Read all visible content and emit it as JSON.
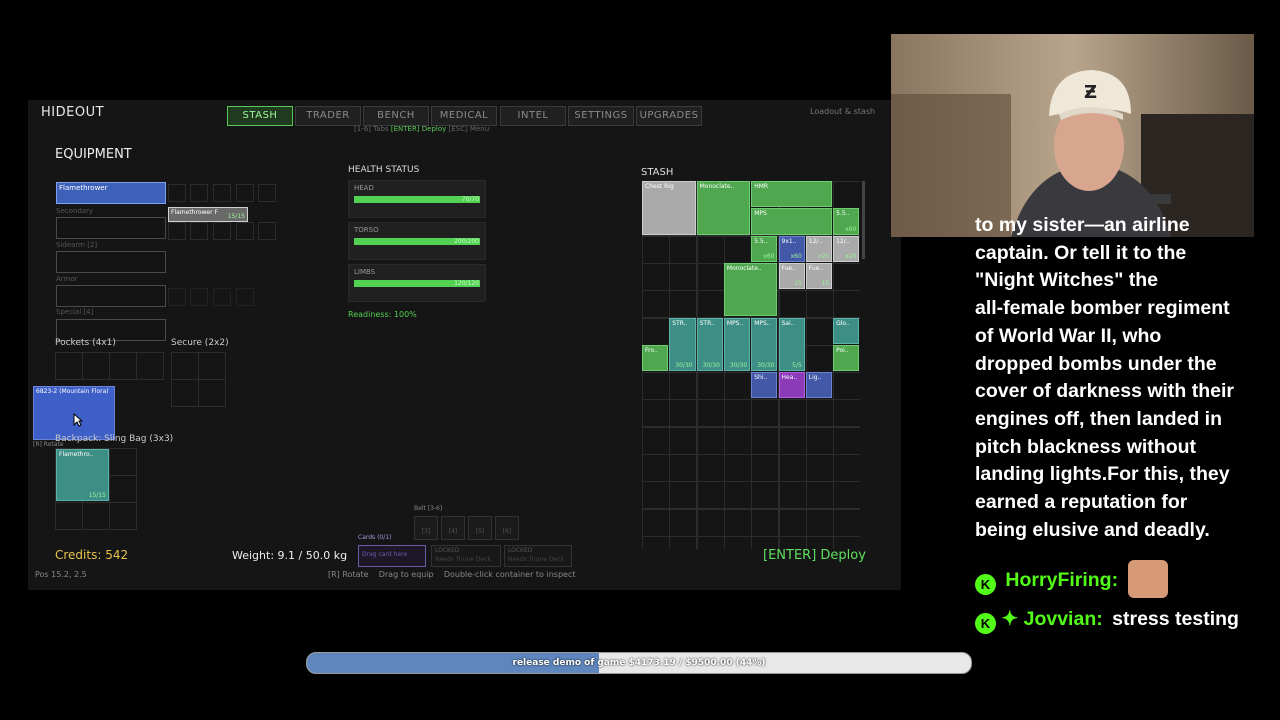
{
  "game": {
    "title": "HIDEOUT",
    "tabs": [
      {
        "label": "STASH",
        "active": true
      },
      {
        "label": "TRADER",
        "active": false
      },
      {
        "label": "BENCH",
        "active": false
      },
      {
        "label": "MEDICAL",
        "active": false
      },
      {
        "label": "INTEL",
        "active": false
      },
      {
        "label": "SETTINGS",
        "active": false
      },
      {
        "label": "UPGRADES",
        "active": false
      }
    ],
    "tab_hint_1": "[1-6] Tabs",
    "tab_hint_2": "[ENTER] Deploy",
    "tab_hint_3": "[ESC] Menu",
    "top_right": "Loadout & stash",
    "equipment": {
      "header": "EQUIPMENT",
      "primary_item": "Flamethrower",
      "secondary_label": "Secondary",
      "ammo_item": "Flamethrower F",
      "ammo_qty": "15/15",
      "sidearm_label": "Sidearm [2]",
      "armor_label": "Armor",
      "special_label": "Special [4]",
      "pockets_label": "Pockets (4x1)",
      "secure_label": "Secure (2x2)",
      "held_item": "6823-2 (Mountain Flora)",
      "rotate_hint": "[R] Rotate",
      "bag_label": "Backpack: Sling Bag (3x3)",
      "bag_item": "Flamethro..",
      "bag_item_qty": "15/15"
    },
    "health": {
      "header": "HEALTH STATUS",
      "parts": [
        {
          "label": "HEAD",
          "value": "70/70",
          "fraction": 1.0
        },
        {
          "label": "TORSO",
          "value": "200/200",
          "fraction": 1.0
        },
        {
          "label": "LIMBS",
          "value": "120/120",
          "fraction": 1.0
        }
      ],
      "readiness": "Readiness: 100%"
    },
    "stash": {
      "header": "STASH",
      "items": [
        {
          "name": "Chest Rig",
          "color": "gray",
          "qty": ""
        },
        {
          "name": "Monoclate..",
          "color": "green",
          "qty": ""
        },
        {
          "name": "HMR",
          "color": "green",
          "qty": ""
        },
        {
          "name": "MPS",
          "color": "green",
          "qty": ""
        },
        {
          "name": "5.5..",
          "color": "green",
          "qty": "x60"
        },
        {
          "name": "5.5..",
          "color": "green",
          "qty": "x60"
        },
        {
          "name": "9x1..",
          "color": "blue",
          "qty": "x60"
        },
        {
          "name": "12/..",
          "color": "gray",
          "qty": "x20"
        },
        {
          "name": "12/..",
          "color": "gray",
          "qty": "x20"
        },
        {
          "name": "Monoclate..",
          "color": "green",
          "qty": ""
        },
        {
          "name": "Fue..",
          "color": "gray",
          "qty": "15"
        },
        {
          "name": "Fue..",
          "color": "gray",
          "qty": "15"
        },
        {
          "name": "STR..",
          "color": "teal",
          "qty": "30/30"
        },
        {
          "name": "STR..",
          "color": "teal",
          "qty": "30/30"
        },
        {
          "name": "MPS..",
          "color": "teal",
          "qty": "30/30"
        },
        {
          "name": "MPS..",
          "color": "teal",
          "qty": "30/30"
        },
        {
          "name": "Sai..",
          "color": "teal",
          "qty": "5/5"
        },
        {
          "name": "Glo..",
          "color": "teal",
          "qty": ""
        },
        {
          "name": "Fro..",
          "color": "green",
          "qty": ""
        },
        {
          "name": "Poi..",
          "color": "green",
          "qty": ""
        },
        {
          "name": "Shi..",
          "color": "blue",
          "qty": ""
        },
        {
          "name": "Hea..",
          "color": "purple",
          "qty": ""
        },
        {
          "name": "Lig..",
          "color": "blue",
          "qty": ""
        }
      ]
    },
    "belt_label": "Belt [3-6]",
    "belt_slots": [
      "[3]",
      "[4]",
      "[5]",
      "[6]"
    ],
    "cards_label": "Cards (0/1)",
    "cards_slot": "Drag card here",
    "locked_1_title": "LOCKED",
    "locked_1_sub": "Needs Triune Deck",
    "locked_2_title": "LOCKED",
    "locked_2_sub": "Needs Triune Deck",
    "credits": "Credits: 542",
    "weight": "Weight: 9.1 / 50.0 kg",
    "deploy": "[ENTER] Deploy",
    "pos": "Pos 15.2, 2.5",
    "hint_rotate": "[R] Rotate",
    "hint_drag": "Drag to equip",
    "hint_inspect": "Double-click container to inspect"
  },
  "chat": {
    "message_lines": [
      "to my sister—an airline",
      "captain. Or tell it to the",
      "\"Night Witches\" the",
      "all-female bomber regiment",
      "of World War II, who",
      "dropped bombs under the",
      "cover of darkness with their",
      "engines off, then landed in",
      "pitch blackness without",
      "landing lights.For this, they",
      "earned a reputation for",
      "being elusive and deadly."
    ],
    "users": [
      {
        "name": "HorryFiring:",
        "message": "",
        "badge": "K",
        "name_color": "#53fc18"
      },
      {
        "name": "Jovvian:",
        "message": "stress testing",
        "badge": "K",
        "name_color": "#53fc18"
      }
    ]
  },
  "progress": {
    "label": "release demo of game $4173.19 / $9500.00 (44%)",
    "fraction": 0.44
  },
  "colors": {
    "accent": "#53fc18",
    "bar_fill": "#5f87bd",
    "game_green": "#4fa84f"
  }
}
